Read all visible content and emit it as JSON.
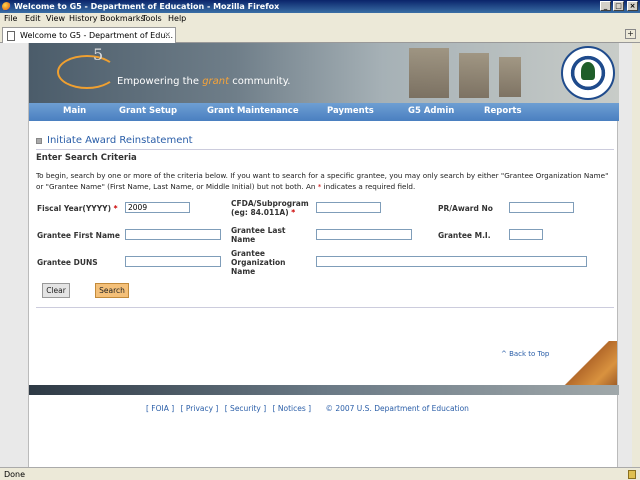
{
  "window": {
    "title": "Welcome to G5 - Department of Education - Mozilla Firefox",
    "min": "_",
    "max": "□",
    "close": "×"
  },
  "menu": [
    "File",
    "Edit",
    "View",
    "History",
    "Bookmarks",
    "Tools",
    "Help"
  ],
  "tab": {
    "label": "Welcome to G5 - Department of Edu...",
    "close": "×",
    "new": "+"
  },
  "banner": {
    "logo_text": "5",
    "tagline_pre": "Empowering the ",
    "tagline_accent": "grant",
    "tagline_post": " community."
  },
  "nav": [
    "Main",
    "Grant Setup",
    "Grant Maintenance",
    "Payments",
    "G5 Admin",
    "Reports"
  ],
  "page_title": "Initiate Award Reinstatement",
  "section_title": "Enter Search Criteria",
  "instructions": {
    "pre": "To begin, search by one or more of the criteria below. If you want to search for a specific grantee, you may only search by either \"Grantee Organization Name\" or \"Grantee Name\" (First Name, Last Name, or Middle Initial) but not both. An ",
    "star": "*",
    "post": " indicates a required field."
  },
  "form": {
    "fiscal_year": {
      "label": "Fiscal Year(YYYY)",
      "value": "2009"
    },
    "cfda": {
      "label": "CFDA/Subprogram (eg: 84.011A)",
      "value": ""
    },
    "pr_award": {
      "label": "PR/Award No",
      "value": ""
    },
    "first_name": {
      "label": "Grantee First Name",
      "value": ""
    },
    "last_name": {
      "label": "Grantee Last Name",
      "value": ""
    },
    "mi": {
      "label": "Grantee M.I.",
      "value": ""
    },
    "duns": {
      "label": "Grantee DUNS",
      "value": ""
    },
    "org_name": {
      "label": "Grantee Organization Name",
      "value": ""
    },
    "required_star": "*"
  },
  "buttons": {
    "clear": "Clear",
    "search": "Search"
  },
  "back_to_top": "^ Back to Top",
  "footer": {
    "links": [
      "[ FOIA ]",
      "[ Privacy ]",
      "[ Security ]",
      "[ Notices ]"
    ],
    "copyright": "© 2007 U.S. Department of Education"
  },
  "status": "Done"
}
